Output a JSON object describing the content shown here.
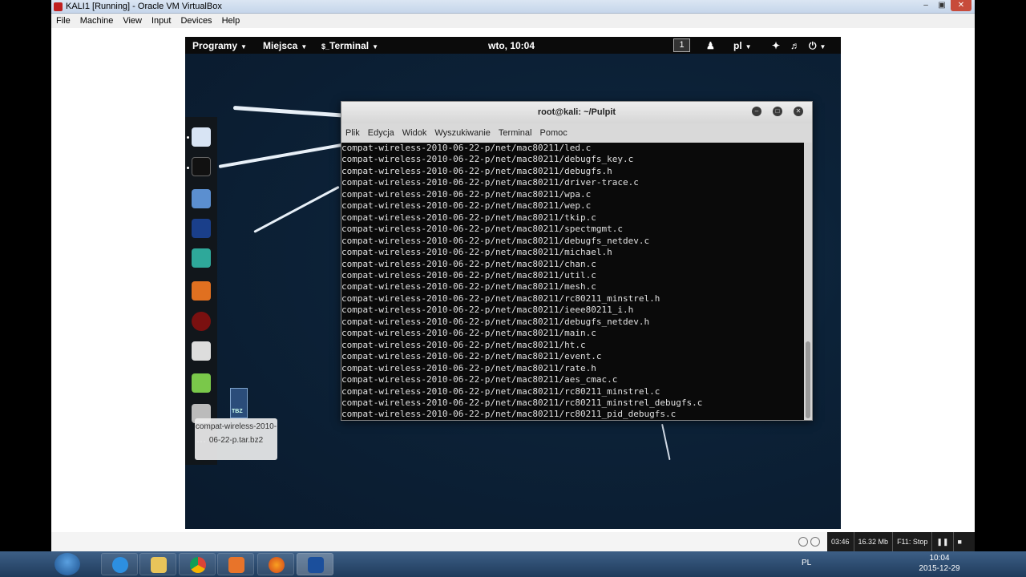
{
  "vbox": {
    "title": "KALI1 [Running] - Oracle VM VirtualBox",
    "menu": [
      "File",
      "Machine",
      "View",
      "Input",
      "Devices",
      "Help"
    ],
    "stats": [
      "03:46",
      "16.32 Mb",
      "F11: Stop"
    ]
  },
  "topbar": {
    "programs": "Programy",
    "places": "Miejsca",
    "terminal": "Terminal",
    "clock": "wto, 10:04",
    "workspace": "1",
    "lang": "pl"
  },
  "desktop": {
    "file_label": "compat-wireless-2010-06-22-p.tar.bz2",
    "file_badge": "TBZ"
  },
  "terminal": {
    "title": "root@kali: ~/Pulpit",
    "menu": [
      "Plik",
      "Edycja",
      "Widok",
      "Wyszukiwanie",
      "Terminal",
      "Pomoc"
    ],
    "lines": [
      "compat-wireless-2010-06-22-p/net/mac80211/led.c",
      "compat-wireless-2010-06-22-p/net/mac80211/debugfs_key.c",
      "compat-wireless-2010-06-22-p/net/mac80211/debugfs.h",
      "compat-wireless-2010-06-22-p/net/mac80211/driver-trace.c",
      "compat-wireless-2010-06-22-p/net/mac80211/wpa.c",
      "compat-wireless-2010-06-22-p/net/mac80211/wep.c",
      "compat-wireless-2010-06-22-p/net/mac80211/tkip.c",
      "compat-wireless-2010-06-22-p/net/mac80211/spectmgmt.c",
      "compat-wireless-2010-06-22-p/net/mac80211/debugfs_netdev.c",
      "compat-wireless-2010-06-22-p/net/mac80211/michael.h",
      "compat-wireless-2010-06-22-p/net/mac80211/chan.c",
      "compat-wireless-2010-06-22-p/net/mac80211/util.c",
      "compat-wireless-2010-06-22-p/net/mac80211/mesh.c",
      "compat-wireless-2010-06-22-p/net/mac80211/rc80211_minstrel.h",
      "compat-wireless-2010-06-22-p/net/mac80211/ieee80211_i.h",
      "compat-wireless-2010-06-22-p/net/mac80211/debugfs_netdev.h",
      "compat-wireless-2010-06-22-p/net/mac80211/main.c",
      "compat-wireless-2010-06-22-p/net/mac80211/ht.c",
      "compat-wireless-2010-06-22-p/net/mac80211/event.c",
      "compat-wireless-2010-06-22-p/net/mac80211/rate.h",
      "compat-wireless-2010-06-22-p/net/mac80211/aes_cmac.c",
      "compat-wireless-2010-06-22-p/net/mac80211/rc80211_minstrel.c",
      "compat-wireless-2010-06-22-p/net/mac80211/rc80211_minstrel_debugfs.c",
      "compat-wireless-2010-06-22-p/net/mac80211/rc80211_pid_debugfs.c"
    ]
  },
  "taskbar": {
    "lang": "PL",
    "time": "10:04",
    "date": "2015-12-29"
  }
}
